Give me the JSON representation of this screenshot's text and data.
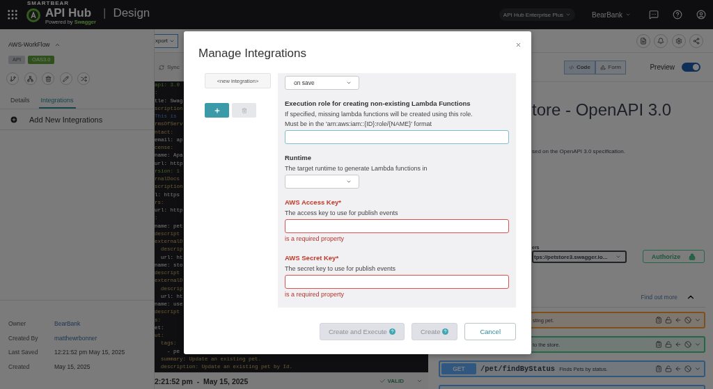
{
  "top_bar": {
    "caption": "SMARTBEAR",
    "product": "API Hub",
    "powered_by": "Powered by **Swagger**",
    "separator": "|",
    "section": "Design",
    "plan": "API Hub Enterprise Plus",
    "org": "BearBank"
  },
  "sidebar": {
    "api_name": "AWS-WorkFlow",
    "badges": [
      {
        "label": "API",
        "kind": "type"
      },
      {
        "label": "OAS3.0",
        "kind": "spec"
      }
    ],
    "tabs": [
      {
        "label": "Details",
        "selected": false
      },
      {
        "label": "Integrations",
        "selected": true
      }
    ],
    "add_action": "Add New Integrations",
    "meta": [
      {
        "label": "Owner",
        "value": "BearBank",
        "kind": "link"
      },
      {
        "label": "Created By",
        "value": "matthewrbonner",
        "kind": "link"
      },
      {
        "label": "Last Saved",
        "value": "12:21:52 pm May 15, 2025",
        "kind": "text"
      },
      {
        "label": "Created",
        "value": "May 15, 2025",
        "kind": "text"
      }
    ]
  },
  "editor": {
    "export_button": "xport",
    "sync_button": "Sync",
    "lines": [
      {
        "text": "api: 3.0",
        "kind": "version"
      },
      {
        "text": ":",
        "kind": "key"
      },
      {
        "text": "tle: Swag",
        "kind": "pair"
      },
      {
        "text": "scription",
        "kind": "key"
      },
      {
        "text": "This is",
        "kind": "text"
      },
      {
        "text": "rmsOfServ",
        "kind": "key"
      },
      {
        "text": "ntact:",
        "kind": "key"
      },
      {
        "text": "email: ap",
        "kind": "pair"
      },
      {
        "text": "cense:",
        "kind": "key"
      },
      {
        "text": "name: Apa",
        "kind": "pair"
      },
      {
        "text": "url: http",
        "kind": "pair"
      },
      {
        "text": "rsion: 1",
        "kind": "version"
      },
      {
        "text": "rnalDocs",
        "kind": "key"
      },
      {
        "text": "scription",
        "kind": "key"
      },
      {
        "text": "l: https",
        "kind": "pair"
      },
      {
        "text": "rs:",
        "kind": "key"
      },
      {
        "text": "url: http",
        "kind": "pair"
      },
      {
        "text": ":",
        "kind": "key"
      },
      {
        "text": "name: pet",
        "kind": "pair"
      },
      {
        "text": "descript",
        "kind": "key"
      },
      {
        "text": "externalD",
        "kind": "key"
      },
      {
        "text": "  descrip",
        "kind": "key"
      },
      {
        "text": "  url: ht",
        "kind": "pair"
      },
      {
        "text": "name: sto",
        "kind": "pair"
      },
      {
        "text": "descript",
        "kind": "key"
      },
      {
        "text": "externalD",
        "kind": "key"
      },
      {
        "text": "  descrip",
        "kind": "key"
      },
      {
        "text": "  url: ht",
        "kind": "pair"
      },
      {
        "text": "name: use",
        "kind": "pair"
      },
      {
        "text": "descript",
        "kind": "key"
      },
      {
        "text": "s:",
        "kind": "key"
      },
      {
        "text": "et:",
        "kind": "pair"
      },
      {
        "text": "ut:",
        "kind": "key"
      },
      {
        "text": "  tags:",
        "kind": "key"
      },
      {
        "text": "    - pe",
        "kind": "pair"
      },
      {
        "text": "  summary: Update an existing pet.",
        "kind": "key"
      },
      {
        "text": "  description: Update an existing pet by Id.",
        "kind": "key"
      }
    ],
    "status": {
      "saved": "2:21:52 pm  -  May 15, 2025",
      "validity": "VALID"
    }
  },
  "preview": {
    "view_modes": [
      {
        "label": "Code",
        "selected": true
      },
      {
        "label": "Form",
        "selected": false
      }
    ],
    "toggle": {
      "label": "Preview",
      "on": true
    },
    "title": "tore - OpenAPI 3.0",
    "description": "sed on the OpenAPI 3.0 specification.",
    "servers": {
      "label": "ers",
      "value": "tps://petstore3.swagger.io..."
    },
    "authorize": "Authorize",
    "find_out_more": "Find out more",
    "operations": [
      {
        "summary": "sting pet.",
        "color": "#7e5018"
      },
      {
        "summary": "to the store.",
        "color": "#246648"
      },
      {
        "method": "GET",
        "path": "/pet/findByStatus",
        "summary": "Finds Pets by status.",
        "color": "#30577f"
      },
      {
        "color": "#30577f"
      }
    ]
  },
  "modal": {
    "title": "Manage Integrations",
    "integrations": [
      "<new integration>"
    ],
    "actions": [
      {
        "kind": "add",
        "disabled": false
      },
      {
        "kind": "delete",
        "disabled": true
      }
    ],
    "fields": [
      {
        "kind": "select",
        "value": "on save"
      },
      {
        "kind": "text",
        "label": "Execution role for creating non-existing Lambda Functions",
        "help": [
          "If specified, missing lambda functions will be created using this role.",
          "Must be in the 'arn:aws:iam::{ID}:role/{NAME}' format"
        ],
        "focused": true
      },
      {
        "kind": "select",
        "label": "Runtime",
        "help": [
          "The target runtime to generate Lambda functions in"
        ]
      },
      {
        "kind": "text",
        "label": "AWS Access Key*",
        "help": [
          "The access key to use for publish events"
        ],
        "error": "is a required property"
      },
      {
        "kind": "text",
        "label": "AWS Secret Key*",
        "help": [
          "The secret key to use for publish events"
        ],
        "error": "is a required property"
      }
    ],
    "buttons": [
      {
        "label": "Create and Execute",
        "kind": "primary",
        "disabled": true,
        "help_icon": true
      },
      {
        "label": "Create",
        "kind": "primary",
        "disabled": true,
        "help_icon": true
      },
      {
        "label": "Cancel",
        "kind": "secondary",
        "disabled": false,
        "help_icon": false
      }
    ]
  }
}
